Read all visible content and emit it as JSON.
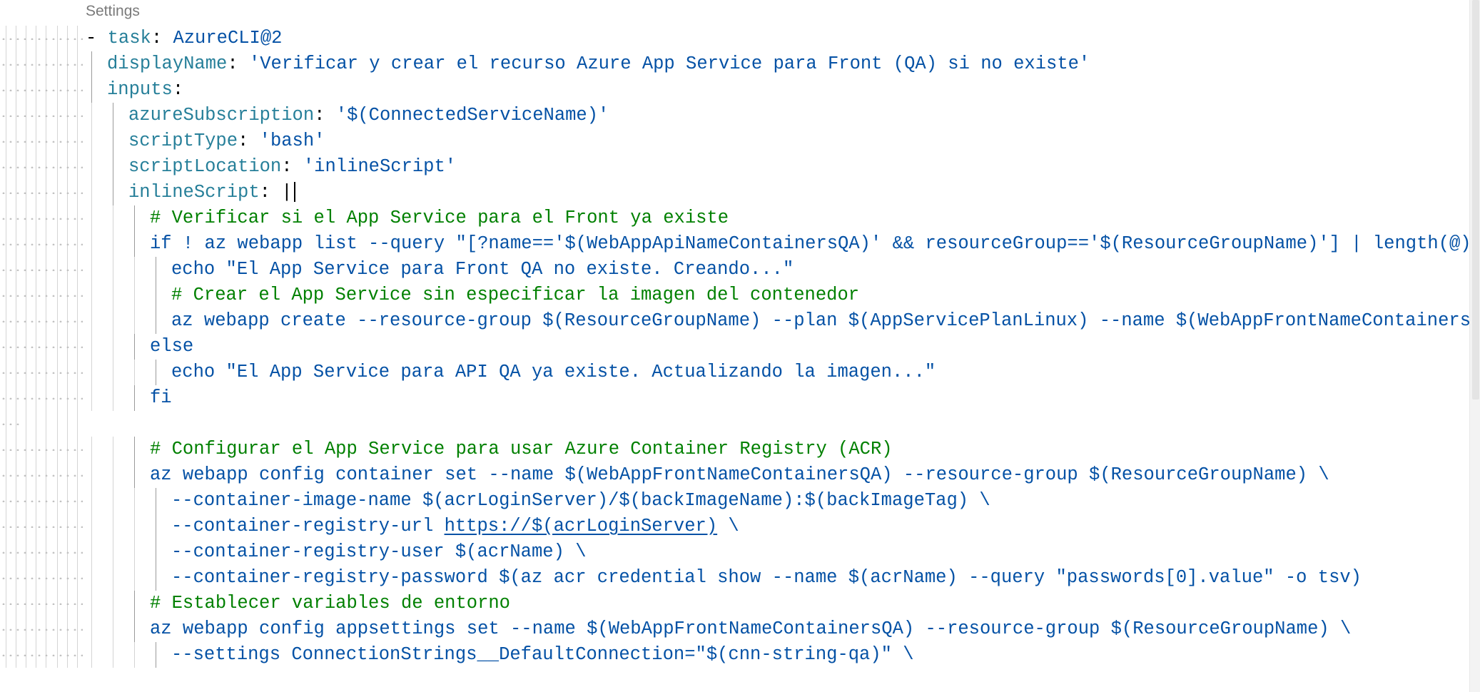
{
  "codelens": "Settings",
  "lines": [
    {
      "indent": 0,
      "parts": [
        [
          "dash",
          "- "
        ],
        [
          "key",
          "task"
        ],
        [
          "punc",
          ": "
        ],
        [
          "str",
          "AzureCLI@2"
        ]
      ]
    },
    {
      "indent": 1,
      "parts": [
        [
          "key",
          "displayName"
        ],
        [
          "punc",
          ": "
        ],
        [
          "str",
          "'Verificar y crear el recurso Azure App Service para Front (QA) si no existe'"
        ]
      ]
    },
    {
      "indent": 1,
      "parts": [
        [
          "key",
          "inputs"
        ],
        [
          "punc",
          ":"
        ]
      ]
    },
    {
      "indent": 2,
      "parts": [
        [
          "key",
          "azureSubscription"
        ],
        [
          "punc",
          ": "
        ],
        [
          "str",
          "'$(ConnectedServiceName)'"
        ]
      ]
    },
    {
      "indent": 2,
      "parts": [
        [
          "key",
          "scriptType"
        ],
        [
          "punc",
          ": "
        ],
        [
          "str",
          "'bash'"
        ]
      ]
    },
    {
      "indent": 2,
      "parts": [
        [
          "key",
          "scriptLocation"
        ],
        [
          "punc",
          ": "
        ],
        [
          "str",
          "'inlineScript'"
        ]
      ]
    },
    {
      "indent": 2,
      "cursor": true,
      "parts": [
        [
          "key",
          "inlineScript"
        ],
        [
          "punc",
          ": "
        ],
        [
          "blockchar",
          "|"
        ]
      ]
    },
    {
      "indent": 3,
      "parts": [
        [
          "comment",
          "# Verificar si el App Service para el Front ya existe"
        ]
      ]
    },
    {
      "indent": 3,
      "parts": [
        [
          "plain",
          "if ! az webapp list --query \"[?name=='$(WebAppApiNameContainersQA)' && resourceGroup=='$(ResourceGroupName)'] | length(@)\""
        ]
      ]
    },
    {
      "indent": 4,
      "parts": [
        [
          "plain",
          "echo \"El App Service para Front QA no existe. Creando...\""
        ]
      ]
    },
    {
      "indent": 4,
      "parts": [
        [
          "comment",
          "# Crear el App Service sin especificar la imagen del contenedor"
        ]
      ]
    },
    {
      "indent": 4,
      "parts": [
        [
          "plain",
          "az webapp create --resource-group $(ResourceGroupName) --plan $(AppServicePlanLinux) --name $(WebAppFrontNameContainersQ"
        ]
      ]
    },
    {
      "indent": 3,
      "parts": [
        [
          "plain",
          "else"
        ]
      ]
    },
    {
      "indent": 4,
      "parts": [
        [
          "plain",
          "echo \"El App Service para API QA ya existe. Actualizando la imagen...\""
        ]
      ]
    },
    {
      "indent": 3,
      "parts": [
        [
          "plain",
          "fi"
        ]
      ]
    },
    {
      "indent": 0,
      "empty": true,
      "parts": []
    },
    {
      "indent": 3,
      "parts": [
        [
          "comment",
          "# Configurar el App Service para usar Azure Container Registry (ACR)"
        ]
      ]
    },
    {
      "indent": 3,
      "parts": [
        [
          "plain",
          "az webapp config container set --name $(WebAppFrontNameContainersQA) --resource-group $(ResourceGroupName) \\"
        ]
      ]
    },
    {
      "indent": 4,
      "parts": [
        [
          "plain",
          "--container-image-name $(acrLoginServer)/$(backImageName):$(backImageTag) \\"
        ]
      ]
    },
    {
      "indent": 4,
      "parts": [
        [
          "plain",
          "--container-registry-url "
        ],
        [
          "link",
          "https://$(acrLoginServer)"
        ],
        [
          "plain",
          " \\"
        ]
      ]
    },
    {
      "indent": 4,
      "parts": [
        [
          "plain",
          "--container-registry-user $(acrName) \\"
        ]
      ]
    },
    {
      "indent": 4,
      "parts": [
        [
          "plain",
          "--container-registry-password $(az acr credential show --name $(acrName) --query \"passwords[0].value\" -o tsv)"
        ]
      ]
    },
    {
      "indent": 3,
      "parts": [
        [
          "comment",
          "# Establecer variables de entorno"
        ]
      ]
    },
    {
      "indent": 3,
      "parts": [
        [
          "plain",
          "az webapp config appsettings set --name $(WebAppFrontNameContainersQA) --resource-group $(ResourceGroupName) \\"
        ]
      ]
    },
    {
      "indent": 4,
      "parts": [
        [
          "plain",
          "--settings ConnectionStrings__DefaultConnection=\"$(cnn-string-qa)\" \\"
        ]
      ]
    }
  ]
}
